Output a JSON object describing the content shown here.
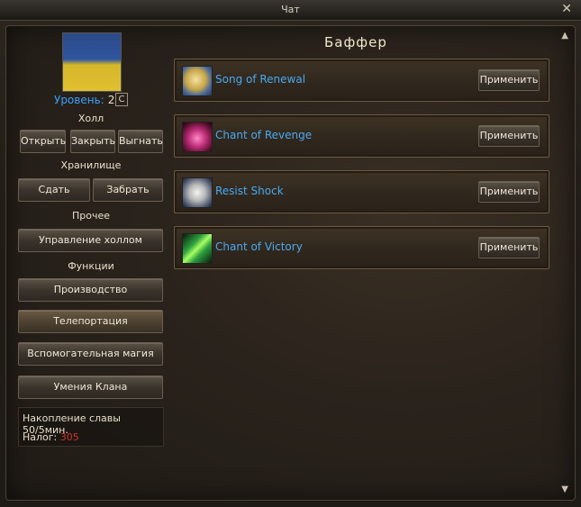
{
  "window": {
    "title": "Чат"
  },
  "left": {
    "level_label": "Уровень:",
    "level_value": "2",
    "clan_badge": "C",
    "hall_title": "Холл",
    "hall_buttons": [
      "Открыть",
      "Закрыть",
      "Выгнать"
    ],
    "storage_title": "Хранилище",
    "storage_buttons": [
      "Сдать",
      "Забрать"
    ],
    "other_title": "Прочее",
    "manage_button": "Управление холлом",
    "functions_title": "Функции",
    "function_buttons": [
      "Производство",
      "Телепортация",
      "Вспомогательная магия",
      "Умения Клана"
    ],
    "fame_text": "Накопление славы 50/5мин.",
    "tax_label": "Налог:",
    "tax_value": "305"
  },
  "main": {
    "title": "Баффер",
    "skills": [
      {
        "name": "Song of Renewal",
        "icon": "song-of-renewal-icon",
        "button": "Применить"
      },
      {
        "name": "Chant of Revenge",
        "icon": "chant-of-revenge-icon",
        "button": "Применить"
      },
      {
        "name": "Resist Shock",
        "icon": "resist-shock-icon",
        "button": "Применить"
      },
      {
        "name": "Chant of Victory",
        "icon": "chant-of-victory-icon",
        "button": "Применить"
      }
    ]
  },
  "colors": {
    "level": "#3aa0ff",
    "skill_name": "#4aa8f0",
    "tax": "#d03030"
  }
}
